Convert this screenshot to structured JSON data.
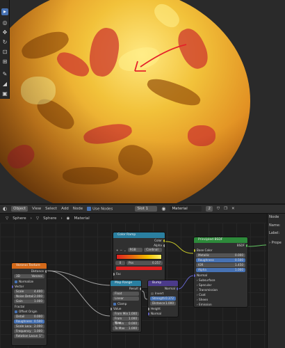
{
  "header": {
    "object_menu": "Object",
    "menus": [
      "View",
      "Select",
      "Add",
      "Node"
    ],
    "use_nodes_label": "Use Nodes",
    "slot": "Slot 1",
    "material": "Material",
    "user_count": "2"
  },
  "breadcrumb": {
    "items": [
      "Sphere",
      "Sphere",
      "Material"
    ]
  },
  "npanel": {
    "title": "Node",
    "name_label": "Name:",
    "label_label": "Label:",
    "properties": "Prope"
  },
  "nodes": {
    "voronoi": {
      "title": "Voronoi Texture",
      "out_distance": "Distance",
      "dims": "3D",
      "feature": "Voronoi",
      "normalize": "Normalize",
      "vector": "Vector",
      "scale": {
        "label": "Scale",
        "value": "4.400"
      },
      "detail": {
        "label": "Noise Detail",
        "value": "2.000"
      },
      "gain": {
        "label": "Gain",
        "value": "1.000"
      },
      "fractal": "Fractal",
      "offset_origin": "Offset Origin",
      "detail2": {
        "label": "Detail",
        "value": "0.000"
      },
      "roughness": {
        "label": "Roughness",
        "value": "0.500"
      },
      "lacunarity": {
        "label": "Scale Lacu",
        "value": "2.000"
      },
      "frequency": {
        "label": "Frequency",
        "value": "1.000"
      },
      "randomness": {
        "label": "Rotation Lacun",
        "value": "1°"
      }
    },
    "colorramp": {
      "title": "Color Ramp",
      "out_color": "Color",
      "out_alpha": "Alpha",
      "mode": "RGB",
      "interp": "Cardinal",
      "stop_index": "0",
      "pos_label": "Pos",
      "pos_value": "0.257",
      "fac": "Fac"
    },
    "maprange": {
      "title": "Map Range",
      "out_result": "Result",
      "type": "Float",
      "interp": "Linear",
      "clamp": "Clamp",
      "value": "Value",
      "from_min": {
        "label": "From Min",
        "value": "1.000"
      },
      "from_max": {
        "label": "From Max",
        "value": "1.000"
      },
      "to_min": {
        "label": "To Min",
        "value": "0.000"
      },
      "to_max": {
        "label": "To Max",
        "value": "1.000"
      }
    },
    "bump": {
      "title": "Bump",
      "out_normal": "Normal",
      "invert": "Invert",
      "strength": {
        "label": "Strength",
        "value": "0.372"
      },
      "distance": {
        "label": "Distance",
        "value": "1.000"
      },
      "height": "Height",
      "normal": "Normal"
    },
    "principled": {
      "title": "Principled BSDF",
      "out_bsdf": "BSDF",
      "base_color": "Base Color",
      "metallic": {
        "label": "Metallic",
        "value": "0.000"
      },
      "roughness": {
        "label": "Roughness",
        "value": "0.500"
      },
      "ior": {
        "label": "IOR",
        "value": "1.450"
      },
      "alpha": {
        "label": "Alpha",
        "value": "1.000"
      },
      "normal": "Normal",
      "panels": [
        "Subsurface",
        "Specular",
        "Transmission",
        "Coat",
        "Sheen",
        "Emission"
      ]
    }
  },
  "colors": {
    "accent": "#4772b3",
    "texture_header": "#d46a1a",
    "converter_header": "#2a7fa0",
    "vector_header": "#4b3a8a",
    "shader_header": "#2d8a3a",
    "annotation_arrow": "#e5222a"
  },
  "icons": [
    "select-box-icon",
    "cursor-icon",
    "move-icon",
    "rotate-icon",
    "scale-icon",
    "transform-icon",
    "annotate-icon",
    "measure-icon",
    "add-cube-icon"
  ]
}
